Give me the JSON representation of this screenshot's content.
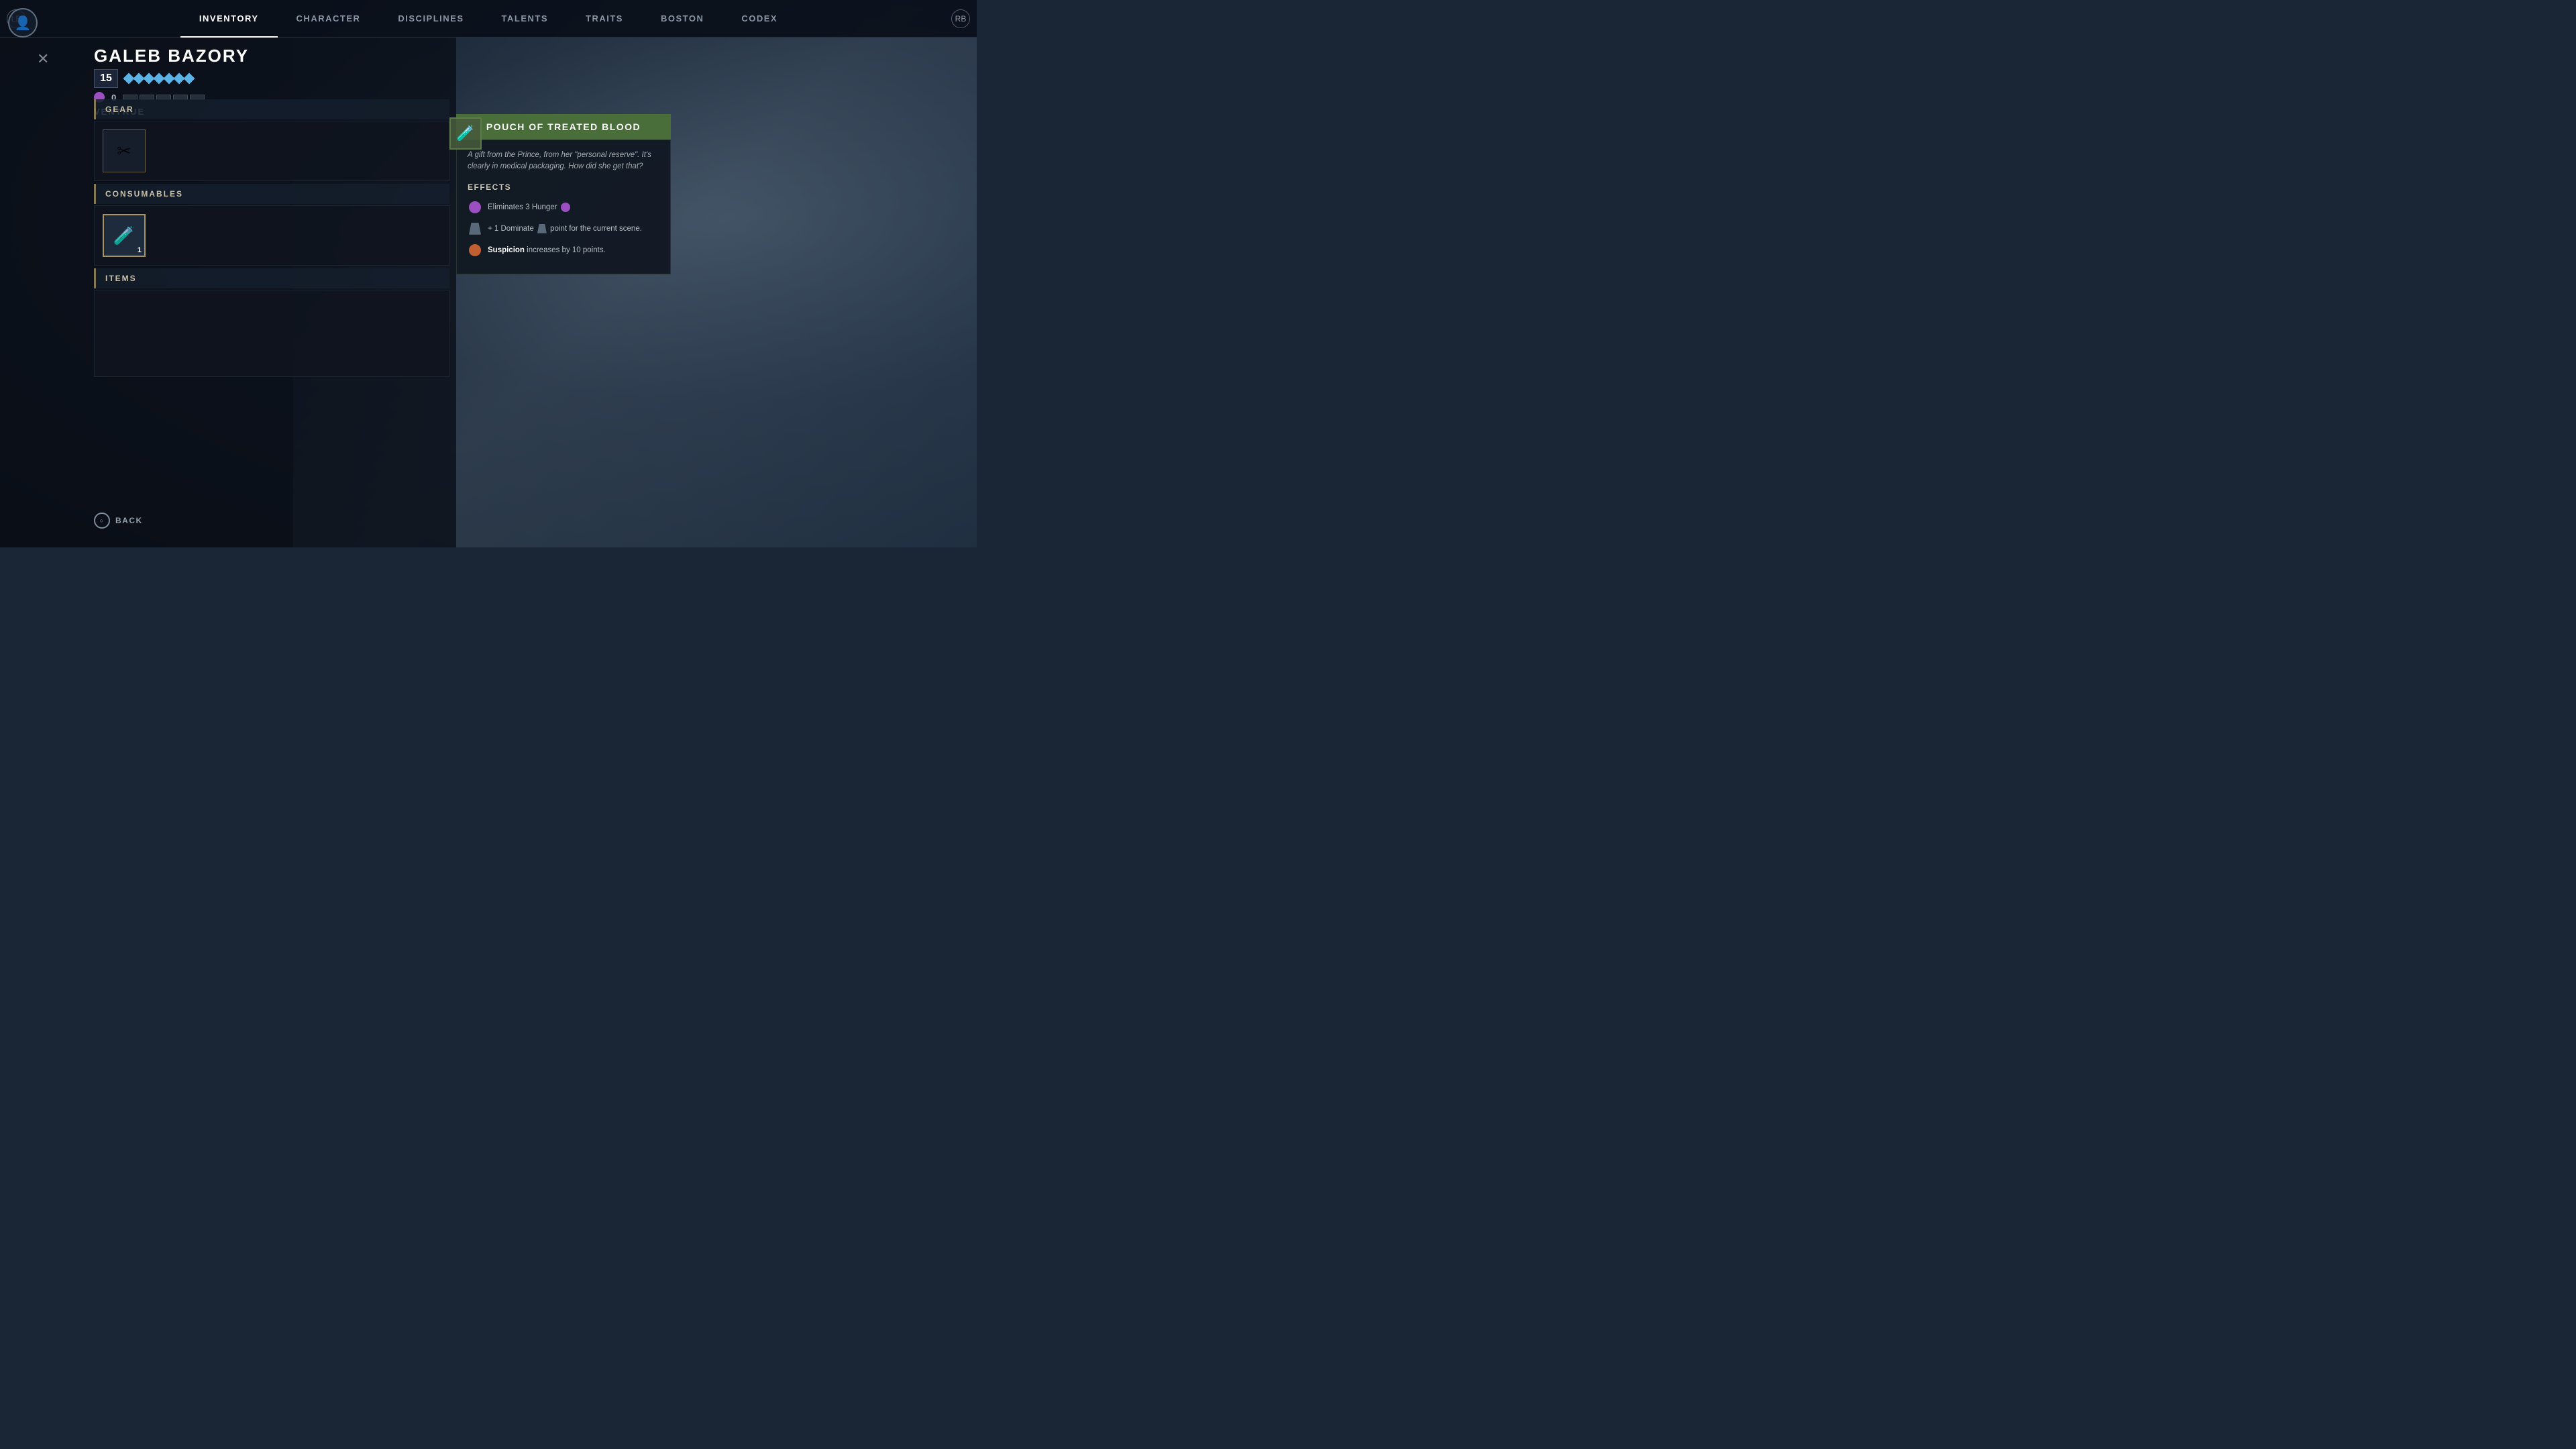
{
  "background": {
    "description": "Dark atmospheric character portrait background"
  },
  "nav": {
    "profile_icon": "👤",
    "left_button": "LB",
    "right_button": "RB",
    "items": [
      {
        "id": "inventory",
        "label": "INVENTORY",
        "active": true
      },
      {
        "id": "character",
        "label": "CHARACTER",
        "active": false
      },
      {
        "id": "disciplines",
        "label": "DISCIPLINES",
        "active": false
      },
      {
        "id": "talents",
        "label": "TALENTS",
        "active": false
      },
      {
        "id": "traits",
        "label": "TRAITS",
        "active": false
      },
      {
        "id": "boston",
        "label": "BOSTON",
        "active": false
      },
      {
        "id": "codex",
        "label": "CODEX",
        "active": false
      }
    ]
  },
  "character": {
    "name": "GALEB BAZORY",
    "clan": "VENTRUE",
    "level": 15,
    "hunger": 0,
    "level_pips": [
      true,
      true,
      true,
      true,
      true,
      true,
      true
    ],
    "hunger_pips": [
      false,
      false,
      false,
      false,
      false
    ]
  },
  "sections": {
    "gear": {
      "header": "GEAR",
      "items": [
        {
          "id": "gear-item-1",
          "icon": "✂",
          "has_item": true
        }
      ]
    },
    "consumables": {
      "header": "CONSUMABLES",
      "items": [
        {
          "id": "consumable-1",
          "icon": "🧪",
          "has_item": true,
          "count": 1,
          "selected": true
        }
      ]
    },
    "items": {
      "header": "ITEMS",
      "items": []
    }
  },
  "tooltip": {
    "title": "POUCH OF TREATED BLOOD",
    "icon": "🧪",
    "description": "A gift from the Prince, from her \"personal reserve\". It's clearly in medical packaging. How did she get that?",
    "effects_label": "EFFECTS",
    "effects": [
      {
        "id": "hunger-effect",
        "icon_type": "hunger",
        "text": "Eliminates 3 Hunger"
      },
      {
        "id": "dominate-effect",
        "icon_type": "dominate",
        "text": "+ 1 Dominate point for the current scene."
      },
      {
        "id": "suspicion-effect",
        "icon_type": "suspicion",
        "text_bold": "Suspicion",
        "text_rest": " increases by 10 points."
      }
    ]
  },
  "close_button": "✕",
  "back": {
    "button_label": "BACK",
    "circle_icon": "○"
  }
}
